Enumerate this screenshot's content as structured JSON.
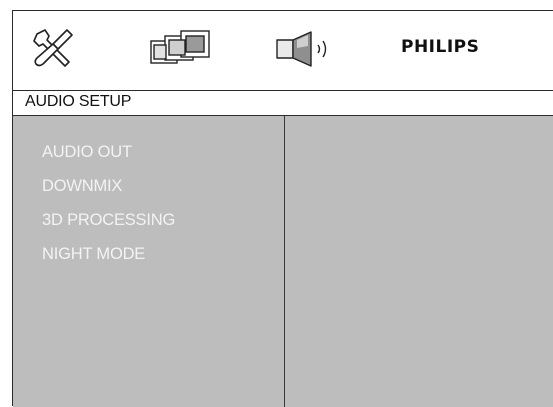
{
  "toolbar": {
    "icons": [
      "tools-icon",
      "video-screens-icon",
      "speaker-icon"
    ],
    "brand": "PHILIPS"
  },
  "title": "AUDIO SETUP",
  "menu": {
    "items": [
      "AUDIO OUT",
      "DOWNMIX",
      "3D PROCESSING",
      "NIGHT MODE"
    ]
  },
  "colors": {
    "panel": "#bdbdbd",
    "menu_text": "#f3f3f3",
    "border": "#2b2b2b"
  }
}
